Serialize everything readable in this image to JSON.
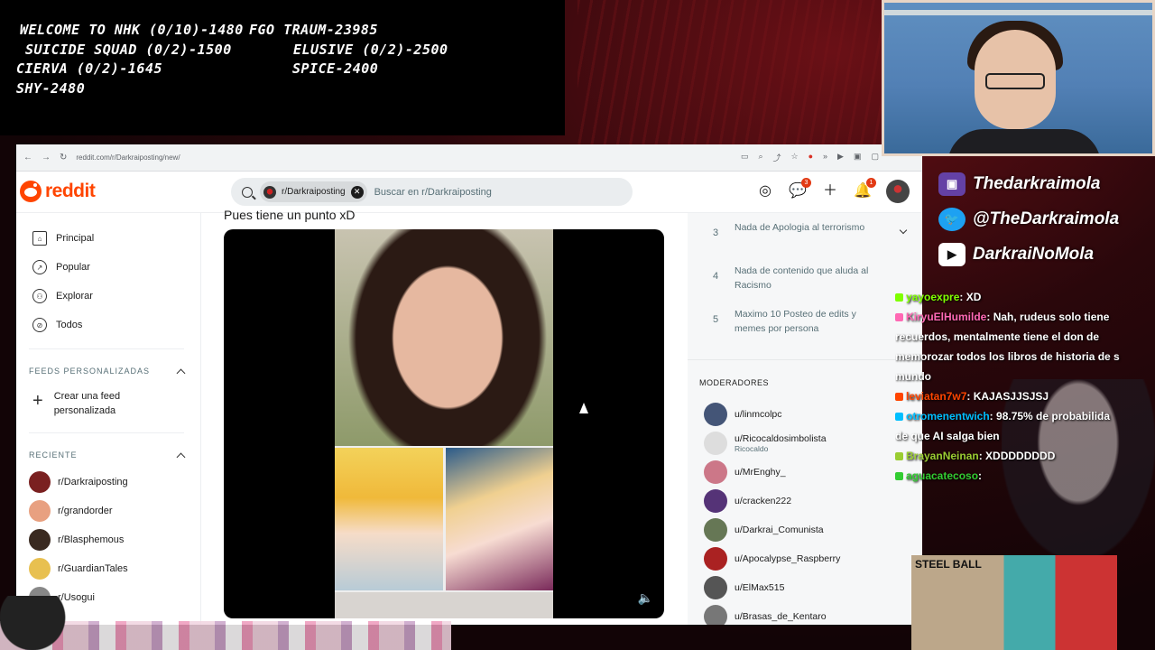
{
  "goals": [
    "WELCOME TO NHK (0/10)-1480",
    "FGO TRAUM-23985",
    "SUICIDE SQUAD (0/2)-1500",
    "ELUSIVE (0/2)-2500",
    "CIERVA (0/2)-1645",
    "SPICE-2400",
    "SHY-2480"
  ],
  "browser": {
    "url": "reddit.com/r/Darkraiposting/new/"
  },
  "header": {
    "logo_text": "reddit",
    "search_chip": "r/Darkraiposting",
    "search_placeholder": "Buscar en r/Darkraiposting",
    "chat_badge": "3",
    "notif_badge": "1"
  },
  "sidebar": {
    "nav": [
      {
        "label": "Principal",
        "icon": "home-icon"
      },
      {
        "label": "Popular",
        "icon": "trend-icon"
      },
      {
        "label": "Explorar",
        "icon": "explore-icon"
      },
      {
        "label": "Todos",
        "icon": "all-icon"
      }
    ],
    "feeds_label": "FEEDS PERSONALIZADAS",
    "create_feed": "Crear una feed personalizada",
    "recent_label": "RECIENTE",
    "recent": [
      {
        "label": "r/Darkraiposting",
        "color": "#7a2020"
      },
      {
        "label": "r/grandorder",
        "color": "#e8a080"
      },
      {
        "label": "r/Blasphemous",
        "color": "#3a2a20"
      },
      {
        "label": "r/GuardianTales",
        "color": "#e8c050"
      },
      {
        "label": "r/Usogui",
        "color": "#888888"
      }
    ]
  },
  "post": {
    "title": "Pues tiene un punto xD"
  },
  "rules": [
    {
      "num": "3",
      "text": "Nada de Apologia al terrorismo"
    },
    {
      "num": "4",
      "text": "Nada de contenido que aluda al Racismo"
    },
    {
      "num": "5",
      "text": "Maximo 10 Posteo de edits y memes por persona"
    }
  ],
  "moderators_label": "MODERADORES",
  "moderators": [
    {
      "name": "u/linmcolpc",
      "flair": "",
      "color": "#445577"
    },
    {
      "name": "u/Ricocaldosimbolista",
      "flair": "Ricocaldo",
      "color": "#dddddd"
    },
    {
      "name": "u/MrEnghy_",
      "flair": "",
      "color": "#cc7788"
    },
    {
      "name": "u/cracken222",
      "flair": "",
      "color": "#553377"
    },
    {
      "name": "u/Darkrai_Comunista",
      "flair": "",
      "color": "#667755"
    },
    {
      "name": "u/Apocalypse_Raspberry",
      "flair": "",
      "color": "#aa2222"
    },
    {
      "name": "u/ElMax515",
      "flair": "",
      "color": "#555555"
    },
    {
      "name": "u/Brasas_de_Kentaro",
      "flair": "",
      "color": "#777777"
    }
  ],
  "socials": [
    {
      "text": "Thedarkraimola",
      "icon": "twitch-icon",
      "color": "#6441a5"
    },
    {
      "text": "@TheDarkraimola",
      "icon": "twitter-icon",
      "color": "#1da1f2"
    },
    {
      "text": "DarkraiNoMola",
      "icon": "youtube-icon",
      "color": "#ff0000"
    }
  ],
  "chat": [
    {
      "user": "yayoexpre",
      "sep": ": ",
      "text": "XD",
      "color": "#7fff00"
    },
    {
      "user": "KiryuElHumilde",
      "sep": ": ",
      "text": "Nah, rudeus solo tiene",
      "color": "#ff69b4"
    },
    {
      "user": "",
      "sep": "",
      "text": "recuerdos, mentalmente tiene el don de",
      "color": "#ffffff"
    },
    {
      "user": "",
      "sep": "",
      "text": "memorozar todos los libros de historia de s",
      "color": "#ffffff"
    },
    {
      "user": "",
      "sep": "",
      "text": "mundo",
      "color": "#ffffff"
    },
    {
      "user": "leviatan7w7",
      "sep": ": ",
      "text": "KAJASJJSJSJ",
      "color": "#ff4500"
    },
    {
      "user": "otromenentwich",
      "sep": ": ",
      "text": "98.75% de probabilida",
      "color": "#00bfff"
    },
    {
      "user": "",
      "sep": "",
      "text": "de que AI salga bien",
      "color": "#ffffff"
    },
    {
      "user": "BrayanNeinan",
      "sep": ": ",
      "text": "XDDDDDDDD",
      "color": "#9acd32"
    },
    {
      "user": "aguacatecoso",
      "sep": ": ",
      "text": "",
      "color": "#32cd32"
    }
  ],
  "manga_label": "STEEL BALL"
}
